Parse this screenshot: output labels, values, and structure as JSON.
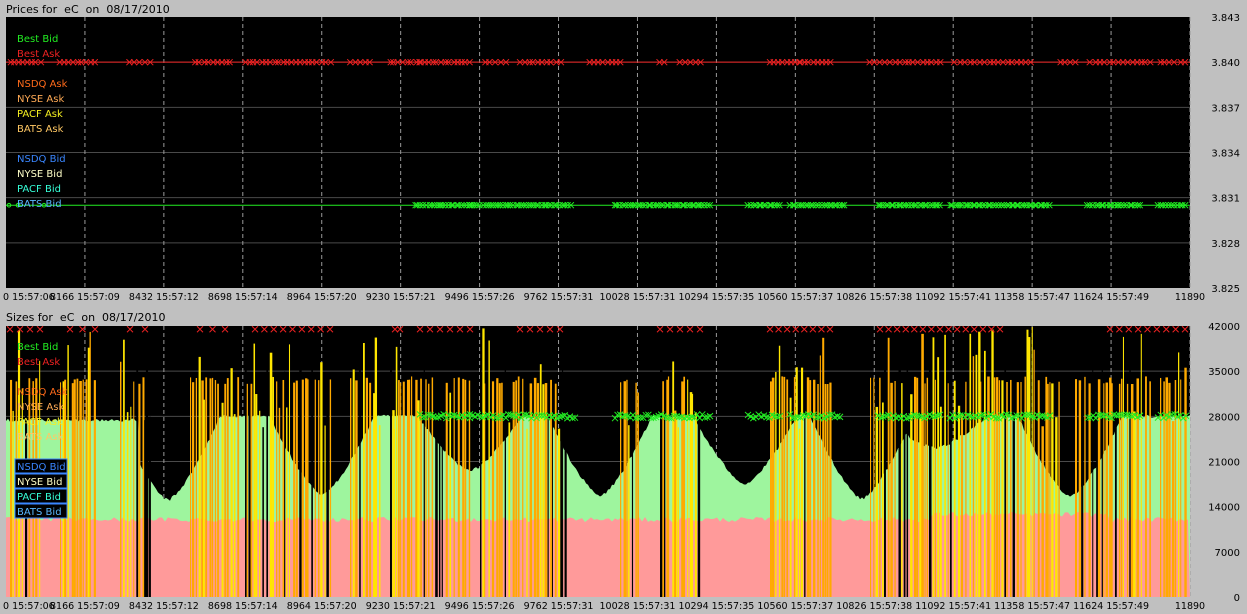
{
  "colors": {
    "best_bid": "#22ee22",
    "best_ask": "#ee2222",
    "nsdq_ask": "#ff6a1a",
    "nyse_ask": "#ffaa55",
    "pacf_ask": "#f5f020",
    "bats_ask": "#ffc864",
    "nsdq_bid": "#3a86ff",
    "nyse_bid": "#ffffc8",
    "pacf_bid": "#36ffd8",
    "bats_bid": "#59b8ff",
    "bid_fill": "#9ef59e",
    "ask_fill": "#ff9a9a",
    "volume_orange": "#ffaa00",
    "volume_yellow": "#ffe600"
  },
  "prices_panel": {
    "title": "Prices for  eC  on  08/17/2010",
    "legend": [
      "Best Bid",
      "Best Ask",
      "NSDQ Ask",
      "NYSE Ask",
      "PACF Ask",
      "BATS Ask",
      "NSDQ Bid",
      "NYSE Bid",
      "PACF Bid",
      "BATS Bid"
    ]
  },
  "sizes_panel": {
    "title": "Sizes for  eC  on  08/17/2010",
    "legend": [
      "Best Bid",
      "Best Ask",
      "NSDQ Ask",
      "NYSE Ask",
      "PACF Ask",
      "BATS Ask",
      "NSDQ Bid",
      "NYSE Bid",
      "PACF Bid",
      "BATS Bid"
    ]
  },
  "chart_data": [
    {
      "type": "line",
      "title": "Prices for  eC  on  08/17/2010",
      "y_tick_labels": [
        "3.843",
        "3.840",
        "3.837",
        "3.834",
        "3.831",
        "3.828",
        "3.825"
      ],
      "ylim": [
        3.825,
        3.843
      ],
      "x_tick_labels": [
        "0 15:57:06",
        "8166 15:57:09",
        "8432 15:57:12",
        "8698 15:57:14",
        "8964 15:57:20",
        "9230 15:57:21",
        "9496 15:57:26",
        "9762 15:57:31",
        "10028 15:57:31",
        "10294 15:57:35",
        "10560 15:57:37",
        "10826 15:57:38",
        "11092 15:57:41",
        "11358 15:57:47",
        "11624 15:57:49",
        "11890"
      ],
      "xlim": [
        7900,
        11890
      ],
      "grid": true,
      "legend_position": "top-left",
      "series": [
        {
          "name": "Best Ask",
          "constant_value": 3.84
        },
        {
          "name": "Best Bid",
          "constant_value": 3.8305
        }
      ]
    },
    {
      "type": "area",
      "title": "Sizes for  eC  on  08/17/2010",
      "y_tick_labels": [
        "42000",
        "35000",
        "28000",
        "21000",
        "14000",
        "7000",
        "0"
      ],
      "ylim": [
        0,
        42000
      ],
      "x_tick_labels": [
        "0 15:57:06",
        "8166 15:57:09",
        "8432 15:57:12",
        "8698 15:57:14",
        "8964 15:57:20",
        "9230 15:57:21",
        "9496 15:57:26",
        "9762 15:57:31",
        "10028 15:57:31",
        "10294 15:57:35",
        "10560 15:57:37",
        "10826 15:57:38",
        "11092 15:57:41",
        "11358 15:57:47",
        "11624 15:57:49",
        "11890"
      ],
      "xlim": [
        7900,
        11890
      ],
      "grid": true,
      "legend_position": "top-left",
      "series": [
        {
          "name": "Best Ask",
          "approx_level": 12000
        },
        {
          "name": "Best Bid",
          "approx_level_range": [
            15000,
            28000
          ]
        },
        {
          "name": "Best Bid",
          "marker_level": 28000
        },
        {
          "name": "Best Ask",
          "marker_level": 41500
        }
      ]
    }
  ]
}
